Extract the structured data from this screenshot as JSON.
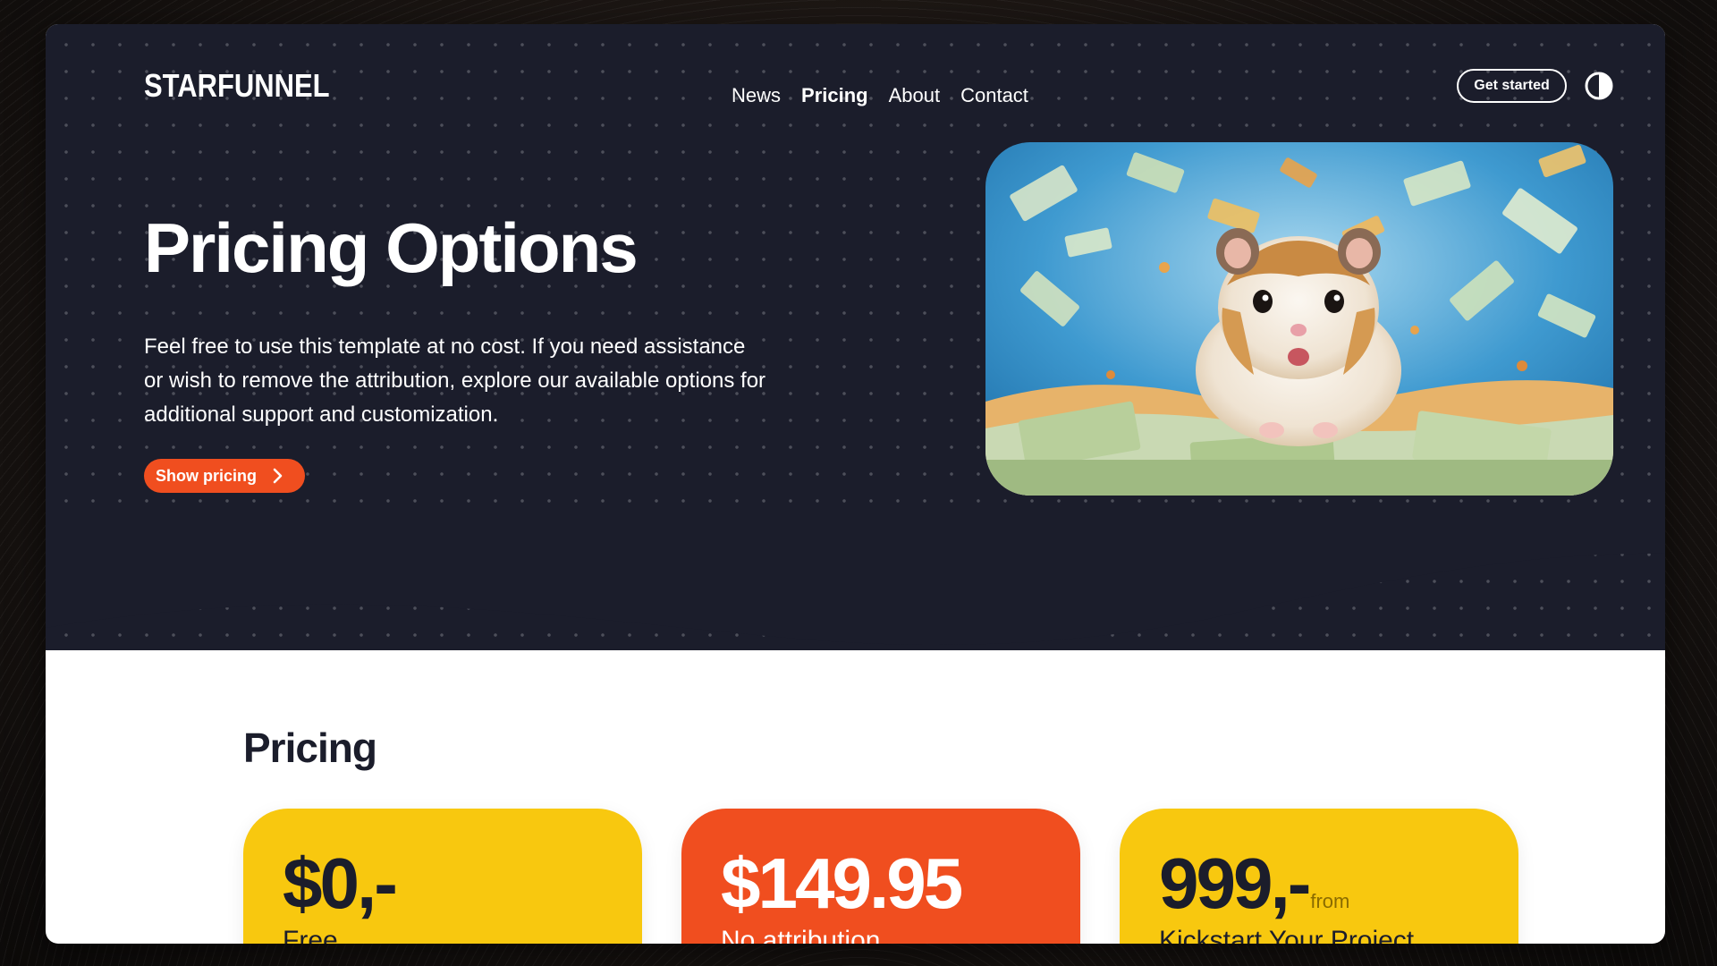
{
  "brand": {
    "logo_text": "STARFUNNEL"
  },
  "nav": {
    "items": [
      {
        "label": "News"
      },
      {
        "label": "Pricing",
        "active": true
      },
      {
        "label": "About"
      },
      {
        "label": "Contact"
      }
    ],
    "cta_label": "Get started",
    "theme_toggle_icon": "contrast-icon"
  },
  "hero": {
    "title": "Pricing Options",
    "description": "Feel free to use this template at no cost. If you need assistance or wish to remove the attribution, explore our available options for additional support and customization.",
    "button_label": "Show pricing",
    "button_icon": "chevron-right-icon",
    "image_subject": "hamster-with-money"
  },
  "pricing": {
    "title": "Pricing",
    "cards": [
      {
        "price": "$0,-",
        "suffix": "",
        "label": "Free",
        "color": "#f8c80f"
      },
      {
        "price": "$149.95",
        "suffix": "",
        "label": "No attribution",
        "color": "#f04e1f"
      },
      {
        "price": "999,-",
        "suffix": "from",
        "label": "Kickstart Your Project",
        "color": "#f8c80f"
      }
    ]
  },
  "colors": {
    "hero_bg": "#1b1d2b",
    "accent_orange": "#f04e1f",
    "accent_yellow": "#f8c80f",
    "text_dark": "#1b1d2b"
  }
}
